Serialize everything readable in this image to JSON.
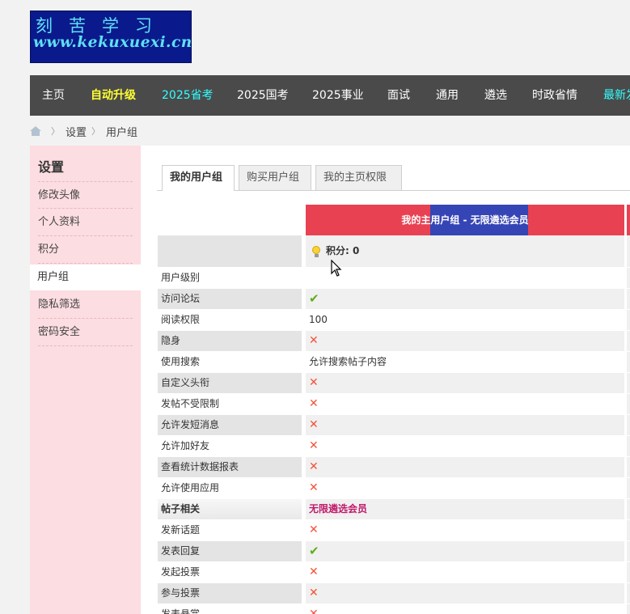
{
  "logo": {
    "line1": "刻苦学习",
    "line2": "www.kekuxuexi.cn"
  },
  "nav": [
    {
      "label": "主页",
      "color": "#ffffff"
    },
    {
      "label": "自动升级",
      "color": "#ffff33"
    },
    {
      "label": "2025省考",
      "color": "#33ffff"
    },
    {
      "label": "2025国考",
      "color": "#ffffff"
    },
    {
      "label": "2025事业",
      "color": "#ffffff"
    },
    {
      "label": "面试",
      "color": "#ffffff"
    },
    {
      "label": "通用",
      "color": "#ffffff"
    },
    {
      "label": "遴选",
      "color": "#ffffff"
    },
    {
      "label": "时政省情",
      "color": "#ffffff"
    },
    {
      "label": "最新发",
      "color": "#33ffff"
    }
  ],
  "breadcrumb": {
    "items": [
      "设置",
      "用户组"
    ]
  },
  "sidebar": {
    "title": "设置",
    "items": [
      "修改头像",
      "个人资料",
      "积分",
      "用户组",
      "隐私筛选",
      "密码安全"
    ],
    "active": "用户组"
  },
  "tabs": [
    "我的用户组",
    "购买用户组",
    "我的主页权限"
  ],
  "group": {
    "header": "我的主用户组 - 无限遴选会员",
    "points_label": "积分: 0"
  },
  "rows": [
    {
      "label": "用户级别",
      "value": "",
      "icon": ""
    },
    {
      "label": "访问论坛",
      "value": "",
      "icon": "check-icon"
    },
    {
      "label": "阅读权限",
      "value": "100",
      "icon": ""
    },
    {
      "label": "隐身",
      "value": "",
      "icon": "cross-icon"
    },
    {
      "label": "使用搜索",
      "value": "允许搜索帖子内容",
      "icon": ""
    },
    {
      "label": "自定义头衔",
      "value": "",
      "icon": "cross-icon"
    },
    {
      "label": "发帖不受限制",
      "value": "",
      "icon": "cross-icon"
    },
    {
      "label": "允许发短消息",
      "value": "",
      "icon": "cross-icon"
    },
    {
      "label": "允许加好友",
      "value": "",
      "icon": "cross-icon"
    },
    {
      "label": "查看统计数据报表",
      "value": "",
      "icon": "cross-icon"
    },
    {
      "label": "允许使用应用",
      "value": "",
      "icon": "cross-icon"
    },
    {
      "label": "帖子相关",
      "value": "无限遴选会员",
      "icon": "",
      "section": true
    },
    {
      "label": "发新话题",
      "value": "",
      "icon": "cross-icon"
    },
    {
      "label": "发表回复",
      "value": "",
      "icon": "check-icon"
    },
    {
      "label": "发起投票",
      "value": "",
      "icon": "cross-icon"
    },
    {
      "label": "参与投票",
      "value": "",
      "icon": "cross-icon"
    },
    {
      "label": "发表悬赏",
      "value": "",
      "icon": "cross-icon"
    }
  ]
}
